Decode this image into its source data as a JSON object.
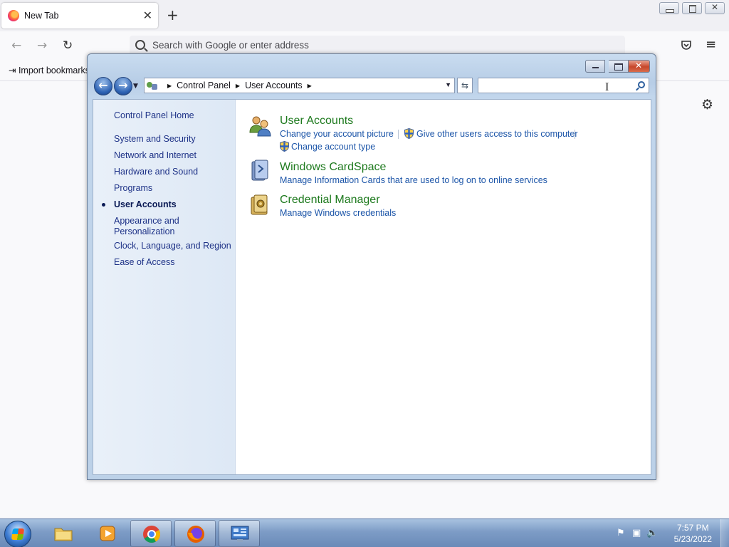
{
  "browser": {
    "tab_title": "New Tab",
    "new_tab_icon": "+",
    "close_tab_icon": "✕",
    "url_placeholder": "Search with Google or enter address",
    "import_bookmarks": "Import bookmarks...",
    "icons": {
      "back": "←",
      "forward": "→",
      "reload": "↻",
      "pocket": "pocket-icon",
      "menu": "≡",
      "settings": "⚙"
    }
  },
  "control_panel": {
    "breadcrumb": [
      "Control Panel",
      "User Accounts"
    ],
    "search_placeholder": "",
    "sidebar": {
      "home": "Control Panel Home",
      "items": [
        "System and Security",
        "Network and Internet",
        "Hardware and Sound",
        "Programs",
        "User Accounts",
        "Appearance and Personalization",
        "Clock, Language, and Region",
        "Ease of Access"
      ],
      "current_index": 4
    },
    "categories": [
      {
        "title": "User Accounts",
        "links": [
          "Change your account picture",
          "Give other users access to this computer",
          "Change account type"
        ]
      },
      {
        "title": "Windows CardSpace",
        "links": [
          "Manage Information Cards that are used to log on to online services"
        ]
      },
      {
        "title": "Credential Manager",
        "links": [
          "Manage Windows credentials"
        ]
      }
    ]
  },
  "taskbar": {
    "pinned": [
      "file-explorer",
      "windows-media-player",
      "google-chrome",
      "firefox",
      "control-panel"
    ],
    "clock_time": "7:57 PM",
    "clock_date": "5/23/2022"
  },
  "colors": {
    "link_blue": "#1c55a8",
    "category_green": "#1e7a1e",
    "sidebar_text": "#1e3287"
  }
}
